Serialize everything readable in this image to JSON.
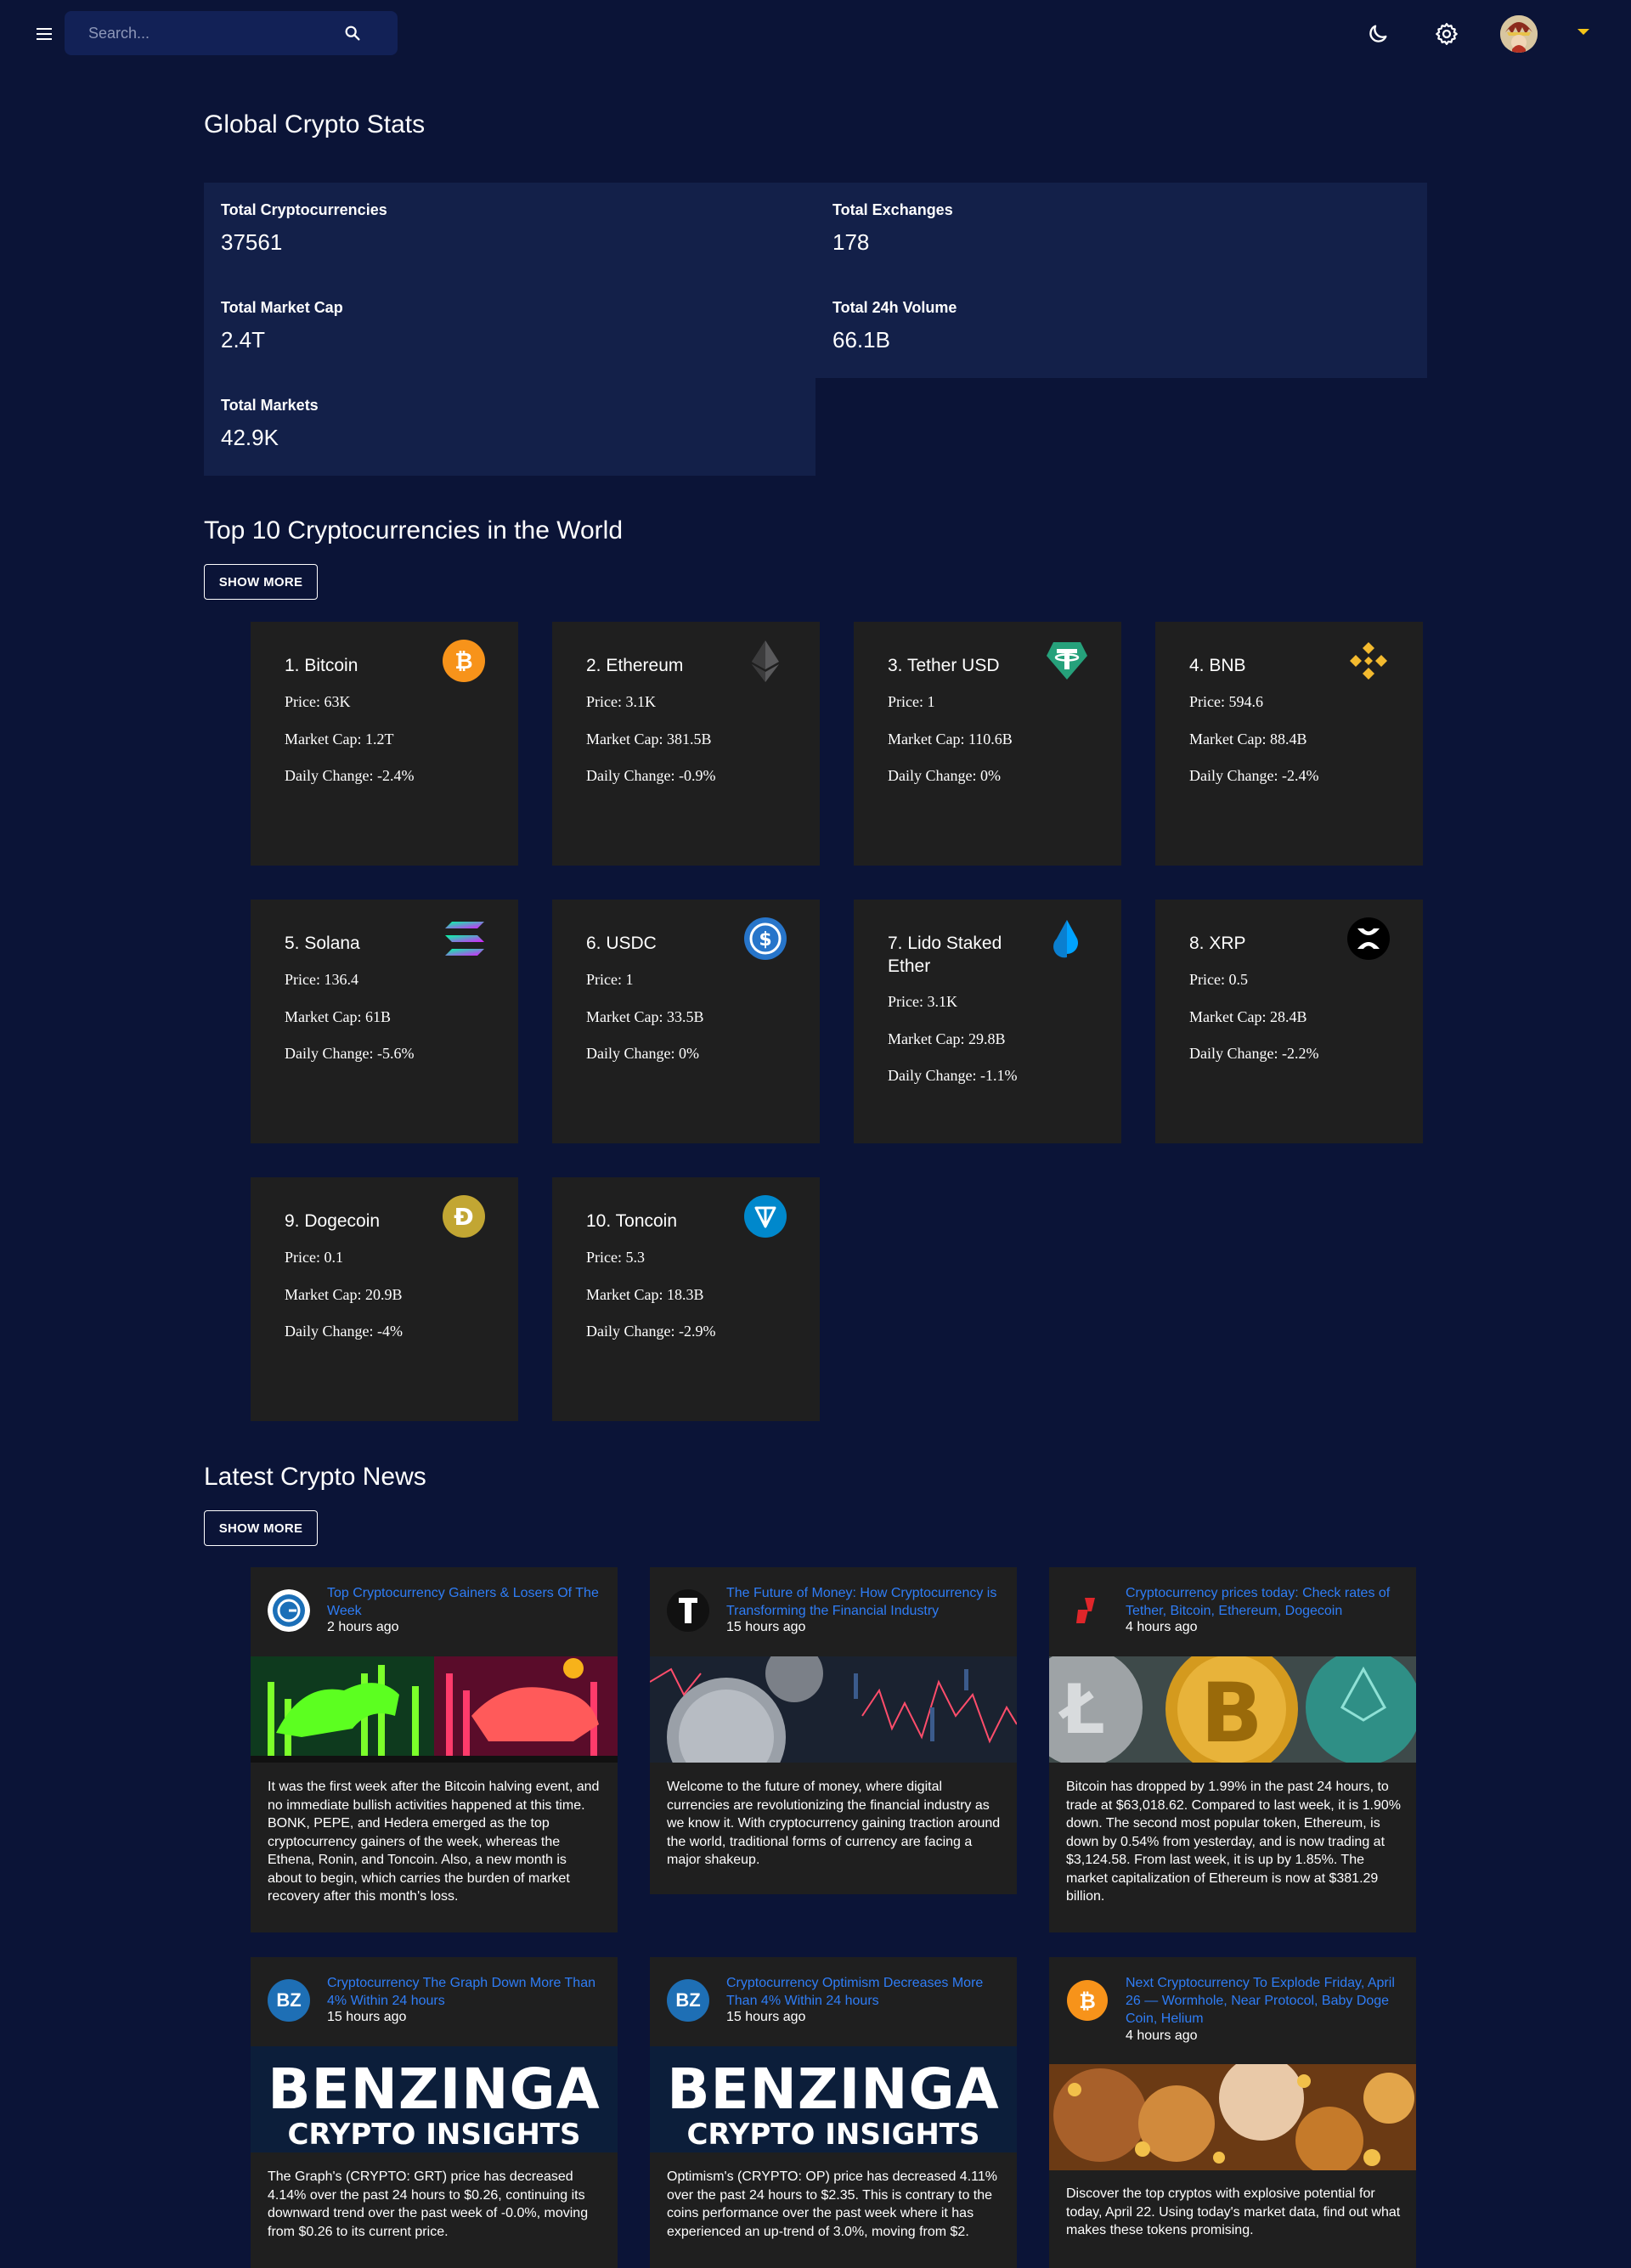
{
  "header": {
    "search_placeholder": "Search..."
  },
  "stats": {
    "title": "Global Crypto Stats",
    "items": [
      {
        "label": "Total Cryptocurrencies",
        "value": "37561"
      },
      {
        "label": "Total Exchanges",
        "value": "178"
      },
      {
        "label": "Total Market Cap",
        "value": "2.4T"
      },
      {
        "label": "Total 24h Volume",
        "value": "66.1B"
      },
      {
        "label": "Total Markets",
        "value": "42.9K"
      }
    ]
  },
  "top10": {
    "title": "Top 10 Cryptocurrencies in the World",
    "show_more": "Show More",
    "coins": [
      {
        "name": "1. Bitcoin",
        "price": "Price: 63K",
        "cap": "Market Cap: 1.2T",
        "change": "Daily Change: -2.4%",
        "icon": "bitcoin-icon",
        "color": "#f7931a"
      },
      {
        "name": "2. Ethereum",
        "price": "Price: 3.1K",
        "cap": "Market Cap: 381.5B",
        "change": "Daily Change: -0.9%",
        "icon": "ethereum-icon",
        "color": "#3c3c3d"
      },
      {
        "name": "3. Tether USD",
        "price": "Price: 1",
        "cap": "Market Cap: 110.6B",
        "change": "Daily Change: 0%",
        "icon": "tether-icon",
        "color": "#26a17b"
      },
      {
        "name": "4. BNB",
        "price": "Price: 594.6",
        "cap": "Market Cap: 88.4B",
        "change": "Daily Change: -2.4%",
        "icon": "bnb-icon",
        "color": "#f3ba2f"
      },
      {
        "name": "5. Solana",
        "price": "Price: 136.4",
        "cap": "Market Cap: 61B",
        "change": "Daily Change: -5.6%",
        "icon": "solana-icon",
        "color": "#9945ff"
      },
      {
        "name": "6. USDC",
        "price": "Price: 1",
        "cap": "Market Cap: 33.5B",
        "change": "Daily Change: 0%",
        "icon": "usdc-icon",
        "color": "#2775ca"
      },
      {
        "name": "7. Lido Staked Ether",
        "price": "Price: 3.1K",
        "cap": "Market Cap: 29.8B",
        "change": "Daily Change: -1.1%",
        "icon": "lido-icon",
        "color": "#00a3ff"
      },
      {
        "name": "8. XRP",
        "price": "Price: 0.5",
        "cap": "Market Cap: 28.4B",
        "change": "Daily Change: -2.2%",
        "icon": "xrp-icon",
        "color": "#000000"
      },
      {
        "name": "9. Dogecoin",
        "price": "Price: 0.1",
        "cap": "Market Cap: 20.9B",
        "change": "Daily Change: -4%",
        "icon": "dogecoin-icon",
        "color": "#c2a633"
      },
      {
        "name": "10. Toncoin",
        "price": "Price: 5.3",
        "cap": "Market Cap: 18.3B",
        "change": "Daily Change: -2.9%",
        "icon": "toncoin-icon",
        "color": "#0088cc"
      }
    ]
  },
  "news": {
    "title": "Latest Crypto News",
    "show_more": "Show More",
    "items": [
      {
        "title": "Top Cryptocurrency Gainers & Losers Of The Week",
        "time": "2 hours ago",
        "desc": "It was the first week after the Bitcoin halving event, and no immediate bullish activities happened at this time. BONK, PEPE, and Hedera emerged as the top cryptocurrency gainers of the week, whereas the Ethena, Ronin, and Toncoin. Also, a new month is about to begin, which carries the burden of market recovery after this month's loss.",
        "icon": "coingape-icon",
        "image": "bull-bear-image"
      },
      {
        "title": "The Future of Money: How Cryptocurrency is Transforming the Financial Industry",
        "time": "15 hours ago",
        "desc": "Welcome to the future of money, where digital currencies are revolutionizing the financial industry as we know it. With cryptocurrency gaining traction around the world, traditional forms of currency are facing a major shakeup.",
        "icon": "tech-t-icon",
        "image": "coins-chart-image"
      },
      {
        "title": "Cryptocurrency prices today: Check rates of Tether, Bitcoin, Ethereum, Dogecoin",
        "time": "4 hours ago",
        "desc": "Bitcoin has dropped by 1.99% in the past 24 hours, to trade at $63,018.62. Compared to last week, it is 1.90% down. The second most popular token, Ethereum, is down by 0.54% from yesterday, and is now trading at $3,124.58. From last week, it is up by 1.85%. The market capitalization of Ethereum is now at $381.29 billion.",
        "icon": "mint-icon",
        "image": "gold-coins-image"
      },
      {
        "title": "Cryptocurrency The Graph Down More Than 4% Within 24 hours",
        "time": "15 hours ago",
        "desc": "The Graph's (CRYPTO: GRT) price has decreased 4.14% over the past 24 hours to $0.26, continuing its downward trend over the past week of -0.0%, moving from $0.26 to its current price.",
        "icon": "benzinga-icon",
        "image": "benzinga-image",
        "img_title": "BENZINGA",
        "img_sub": "CRYPTO INSIGHTS"
      },
      {
        "title": "Cryptocurrency Optimism Decreases More Than 4% Within 24 hours",
        "time": "15 hours ago",
        "desc": "Optimism's (CRYPTO: OP) price has decreased 4.11% over the past 24 hours to $2.35. This is contrary to the coins performance over the past week where it has experienced an up-trend of 3.0%, moving from $2.",
        "icon": "benzinga-icon",
        "image": "benzinga-image",
        "img_title": "BENZINGA",
        "img_sub": "CRYPTO INSIGHTS"
      },
      {
        "title": "Next Cryptocurrency To Explode Friday, April 26 — Wormhole, Near Protocol, Baby Doge Coin, Helium",
        "time": "4 hours ago",
        "desc": "Discover the top cryptos with explosive potential for today, April 22. Using today's market data, find out what makes these tokens promising.",
        "icon": "bitcoin-icon",
        "image": "explosion-image"
      }
    ]
  },
  "badges": {
    "bz": "BZ",
    "t": "T"
  }
}
